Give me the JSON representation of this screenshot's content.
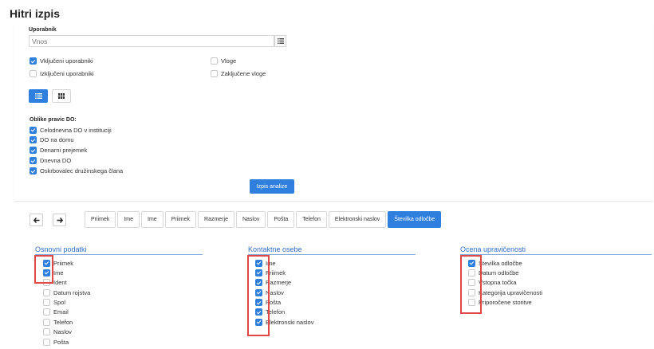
{
  "page": {
    "title": "Hitri izpis"
  },
  "filter": {
    "user_label": "Uporabnik",
    "user_placeholder": "Vnos",
    "options_left": [
      {
        "label": "Vključeni uporabniki",
        "checked": true
      },
      {
        "label": "Izključeni uporabniki",
        "checked": false
      }
    ],
    "options_right": [
      {
        "label": "Vloge",
        "checked": false
      },
      {
        "label": "Zaključene vloge",
        "checked": false
      }
    ],
    "forms_label": "Oblike pravic DO:",
    "forms": [
      {
        "label": "Celodnevna DO v instituciji",
        "checked": true
      },
      {
        "label": "DO na domu",
        "checked": true
      },
      {
        "label": "Denarni prejemek",
        "checked": true
      },
      {
        "label": "Dnevna DO",
        "checked": true
      },
      {
        "label": "Oskrbovalec družinskega člana",
        "checked": true
      }
    ],
    "run_button": "Izpis analize"
  },
  "nav": {
    "back_icon": "arrow-left-icon",
    "forward_icon": "arrow-right-icon"
  },
  "tabs": [
    "Priimek",
    "Ime",
    "Ime",
    "Priimek",
    "Razmerje",
    "Naslov",
    "Pošta",
    "Telefon",
    "Elektronski naslov",
    "Številka odločbe"
  ],
  "active_tab_index": 9,
  "sections": [
    {
      "title": "Osnovni podatki",
      "items": [
        {
          "label": "Priimek",
          "checked": true
        },
        {
          "label": "Ime",
          "checked": true
        },
        {
          "label": "Ident",
          "checked": false
        },
        {
          "label": "Datum rojstva",
          "checked": false
        },
        {
          "label": "Spol",
          "checked": false
        },
        {
          "label": "Email",
          "checked": false
        },
        {
          "label": "Telefon",
          "checked": false
        },
        {
          "label": "Naslov",
          "checked": false
        },
        {
          "label": "Pošta",
          "checked": false
        }
      ]
    },
    {
      "title": "Kontaktne osebe",
      "items": [
        {
          "label": "Ime",
          "checked": true
        },
        {
          "label": "Priimek",
          "checked": true
        },
        {
          "label": "Razmerje",
          "checked": true
        },
        {
          "label": "Naslov",
          "checked": true
        },
        {
          "label": "Pošta",
          "checked": true
        },
        {
          "label": "Telefon",
          "checked": true
        },
        {
          "label": "Elektronski naslov",
          "checked": true
        }
      ]
    },
    {
      "title": "Ocena upravičenosti",
      "items": [
        {
          "label": "Številka odločbe",
          "checked": true
        },
        {
          "label": "Datum odločbe",
          "checked": false
        },
        {
          "label": "Vstopna točka",
          "checked": false
        },
        {
          "label": "Kategorija upravičenosti",
          "checked": false
        },
        {
          "label": "Priporočene storitve",
          "checked": false
        }
      ]
    }
  ],
  "colors": {
    "accent": "#2f7fde",
    "section_title": "#2f6fc8",
    "highlight": "#e04848"
  }
}
